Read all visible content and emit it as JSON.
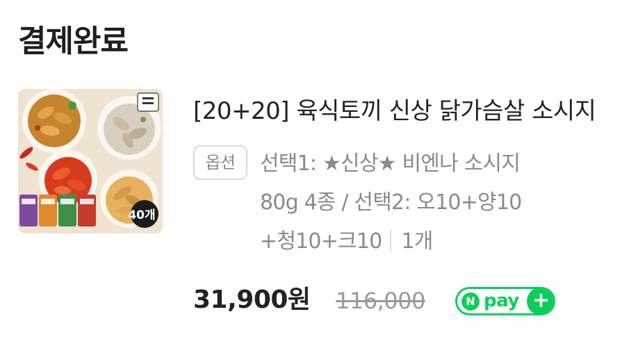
{
  "page": {
    "title": "결제완료"
  },
  "order_item": {
    "image_label": "40개",
    "product_name": "[20+20] 육식토끼 신상 닭가슴살 소시지",
    "option_badge": "옵션",
    "option_line_1": "선택1: ★신상★ 비엔나 소시지",
    "option_line_2": "80g 4종 / 선택2: 오10+양10",
    "option_line_3": "+청10+크10",
    "quantity": "1개",
    "price": "31,900원",
    "original_price": "116,000",
    "payment_badge": {
      "n_letter": "N",
      "text": "pay",
      "plus": "+",
      "color": "#0acf5b"
    }
  }
}
